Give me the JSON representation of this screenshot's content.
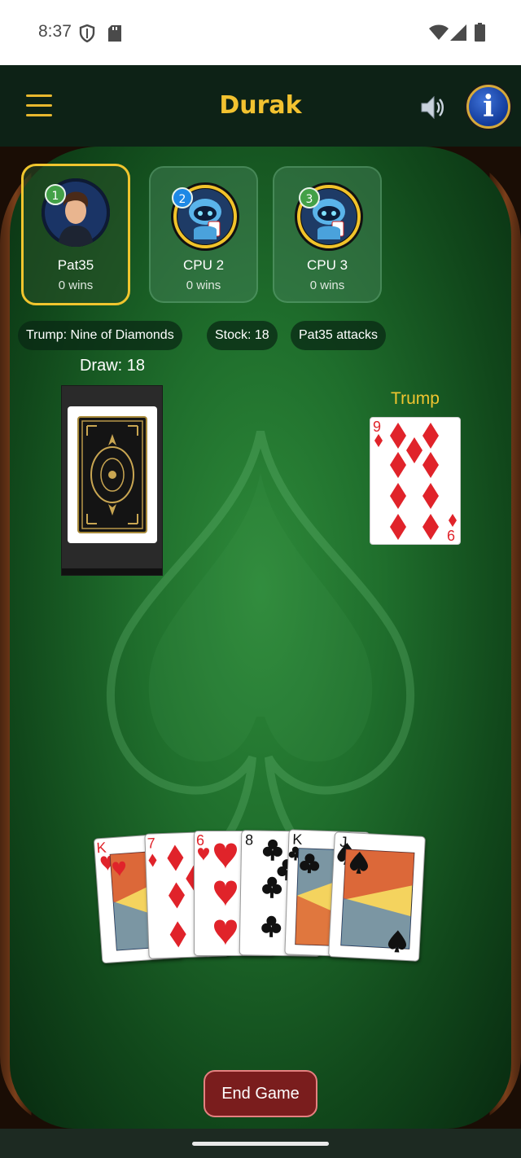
{
  "status_bar": {
    "time": "8:37",
    "icons": [
      "shield-icon",
      "sd-card-icon",
      "wifi-icon",
      "signal-icon",
      "battery-icon"
    ]
  },
  "app_bar": {
    "title": "Durak",
    "icons": [
      "menu-icon",
      "sound-icon",
      "info-icon"
    ],
    "info_glyph": "i"
  },
  "players": [
    {
      "badge": "1",
      "name": "Pat35",
      "wins": "0 wins",
      "active": true,
      "badge_color": "#43a047"
    },
    {
      "badge": "2",
      "name": "CPU 2",
      "wins": "0 wins",
      "active": false,
      "badge_color": "#1e88e5"
    },
    {
      "badge": "3",
      "name": "CPU 3",
      "wins": "0 wins",
      "active": false,
      "badge_color": "#43a047"
    }
  ],
  "status_pills": {
    "trump": "Trump: Nine of Diamonds",
    "stock": "Stock: 18",
    "turn": "Pat35 attacks"
  },
  "draw_pile": {
    "label": "Draw: 18"
  },
  "trump_card": {
    "label": "Trump",
    "rank_top": "9",
    "rank_bottom": "6",
    "suit": "diamonds"
  },
  "hand": [
    {
      "rank": "K",
      "suit": "hearts",
      "color": "red"
    },
    {
      "rank": "7",
      "suit": "diamonds",
      "color": "red"
    },
    {
      "rank": "6",
      "suit": "hearts",
      "color": "red"
    },
    {
      "rank": "8",
      "suit": "clubs",
      "color": "black"
    },
    {
      "rank": "K",
      "suit": "clubs",
      "color": "black"
    },
    {
      "rank": "J",
      "suit": "spades",
      "color": "black"
    }
  ],
  "actions": {
    "end_game": "End Game"
  },
  "colors": {
    "accent": "#f2c230",
    "felt": "#1f6e2c",
    "end_button": "#7a1d1d"
  }
}
